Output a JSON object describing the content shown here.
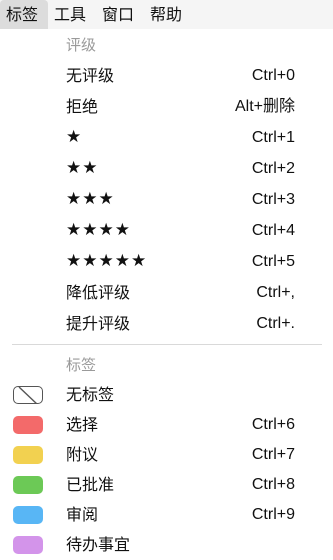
{
  "menubar": {
    "items": [
      "标签",
      "工具",
      "窗口",
      "帮助"
    ]
  },
  "rating_section": {
    "header": "评级",
    "items": [
      {
        "label": "无评级",
        "shortcut": "Ctrl+0"
      },
      {
        "label": "拒绝",
        "shortcut": "Alt+删除"
      },
      {
        "label": "★",
        "shortcut": "Ctrl+1"
      },
      {
        "label": "★★",
        "shortcut": "Ctrl+2"
      },
      {
        "label": "★★★",
        "shortcut": "Ctrl+3"
      },
      {
        "label": "★★★★",
        "shortcut": "Ctrl+4"
      },
      {
        "label": "★★★★★",
        "shortcut": "Ctrl+5"
      },
      {
        "label": "降低评级",
        "shortcut": "Ctrl+,"
      },
      {
        "label": "提升评级",
        "shortcut": "Ctrl+."
      }
    ]
  },
  "label_section": {
    "header": "标签",
    "items": [
      {
        "label": "无标签",
        "shortcut": "",
        "color": "none",
        "icon": "no-label-icon"
      },
      {
        "label": "选择",
        "shortcut": "Ctrl+6",
        "color": "#f36a6a",
        "icon": "red-swatch-icon"
      },
      {
        "label": "附议",
        "shortcut": "Ctrl+7",
        "color": "#f2d150",
        "icon": "yellow-swatch-icon"
      },
      {
        "label": "已批准",
        "shortcut": "Ctrl+8",
        "color": "#6cc956",
        "icon": "green-swatch-icon"
      },
      {
        "label": "审阅",
        "shortcut": "Ctrl+9",
        "color": "#58b6f5",
        "icon": "blue-swatch-icon"
      },
      {
        "label": "待办事宜",
        "shortcut": "",
        "color": "#d394ea",
        "icon": "purple-swatch-icon"
      }
    ]
  }
}
